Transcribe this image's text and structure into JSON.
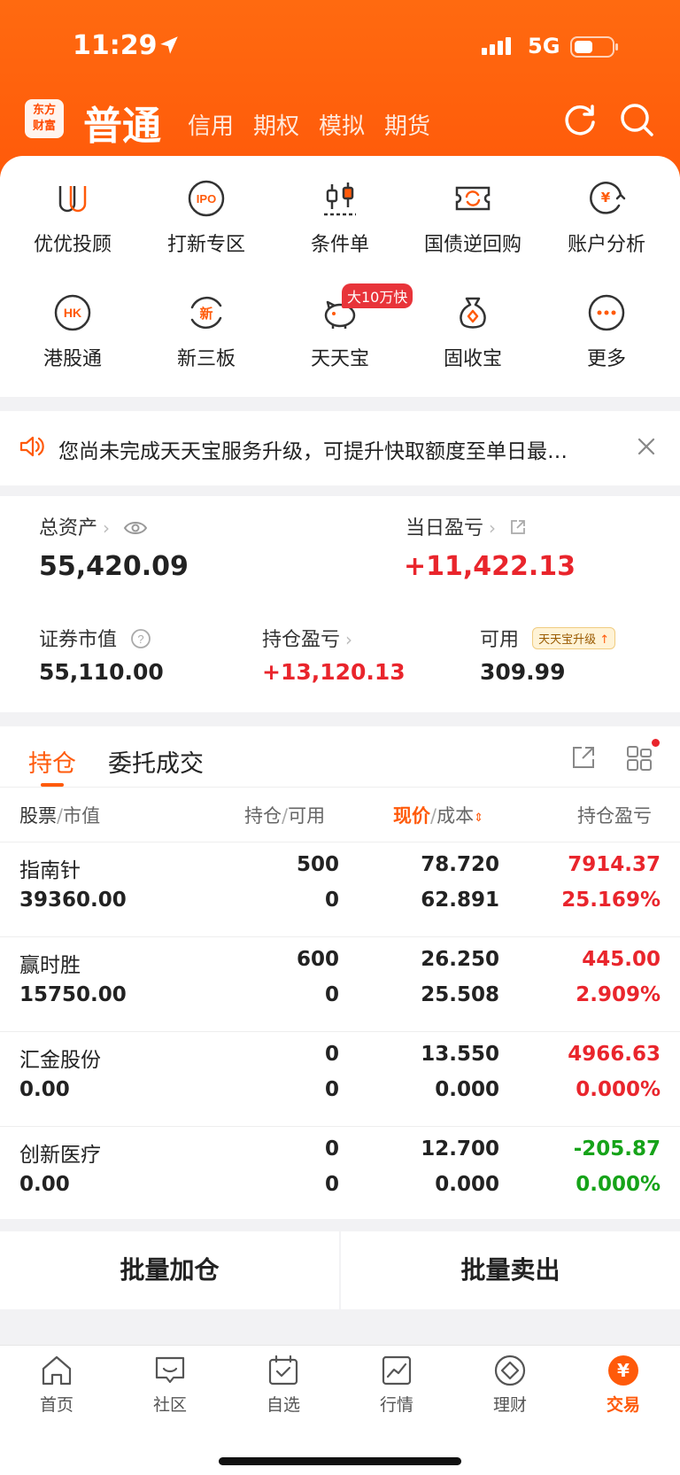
{
  "status_bar": {
    "time": "11:29",
    "network": "5G"
  },
  "header": {
    "logo_line1": "东方",
    "logo_line2": "财富",
    "active_tab": "普通",
    "tabs": [
      "信用",
      "期权",
      "模拟",
      "期货"
    ]
  },
  "menu": {
    "row1": [
      "优优投顾",
      "打新专区",
      "条件单",
      "国债逆回购",
      "账户分析"
    ],
    "row2": [
      "港股通",
      "新三板",
      "天天宝",
      "固收宝",
      "更多"
    ],
    "ipo_icon_text": "IPO",
    "hk_icon_text": "HK",
    "xin_icon_text": "新",
    "promo_badge": "大10万快"
  },
  "notice": {
    "text": "您尚未完成天天宝服务升级，可提升快取额度至单日最…"
  },
  "assets": {
    "total_label": "总资产",
    "total_value": "55,420.09",
    "daily_pl_label": "当日盈亏",
    "daily_pl_value": "+11,422.13",
    "market_value_label": "证券市值",
    "market_value": "55,110.00",
    "position_pl_label": "持仓盈亏",
    "position_pl_value": "+13,120.13",
    "available_label": "可用",
    "available_badge": "天天宝升级",
    "available_value": "309.99"
  },
  "positions": {
    "tabs": [
      "持仓",
      "委托成交"
    ],
    "columns": {
      "stock": "股票",
      "market_value": "市值",
      "hold": "持仓",
      "usable": "可用",
      "price": "现价",
      "cost": "成本",
      "pl": "持仓盈亏"
    },
    "rows": [
      {
        "name": "指南针",
        "value": "39360.00",
        "hold": "500",
        "usable": "0",
        "price": "78.720",
        "cost": "62.891",
        "pl": "7914.37",
        "pl_pct": "25.169%",
        "dir": "up"
      },
      {
        "name": "赢时胜",
        "value": "15750.00",
        "hold": "600",
        "usable": "0",
        "price": "26.250",
        "cost": "25.508",
        "pl": "445.00",
        "pl_pct": "2.909%",
        "dir": "up"
      },
      {
        "name": "汇金股份",
        "value": "0.00",
        "hold": "0",
        "usable": "0",
        "price": "13.550",
        "cost": "0.000",
        "pl": "4966.63",
        "pl_pct": "0.000%",
        "dir": "up"
      },
      {
        "name": "创新医疗",
        "value": "0.00",
        "hold": "0",
        "usable": "0",
        "price": "12.700",
        "cost": "0.000",
        "pl": "-205.87",
        "pl_pct": "0.000%",
        "dir": "down"
      }
    ]
  },
  "actions": {
    "batch_add": "批量加仓",
    "batch_sell": "批量卖出"
  },
  "bottom_nav": {
    "items": [
      "首页",
      "社区",
      "自选",
      "行情",
      "理财",
      "交易"
    ],
    "active": "交易",
    "trade_icon_text": "¥"
  },
  "colors": {
    "brand": "#ff5a0a",
    "up": "#e9252c",
    "down": "#16a319"
  }
}
